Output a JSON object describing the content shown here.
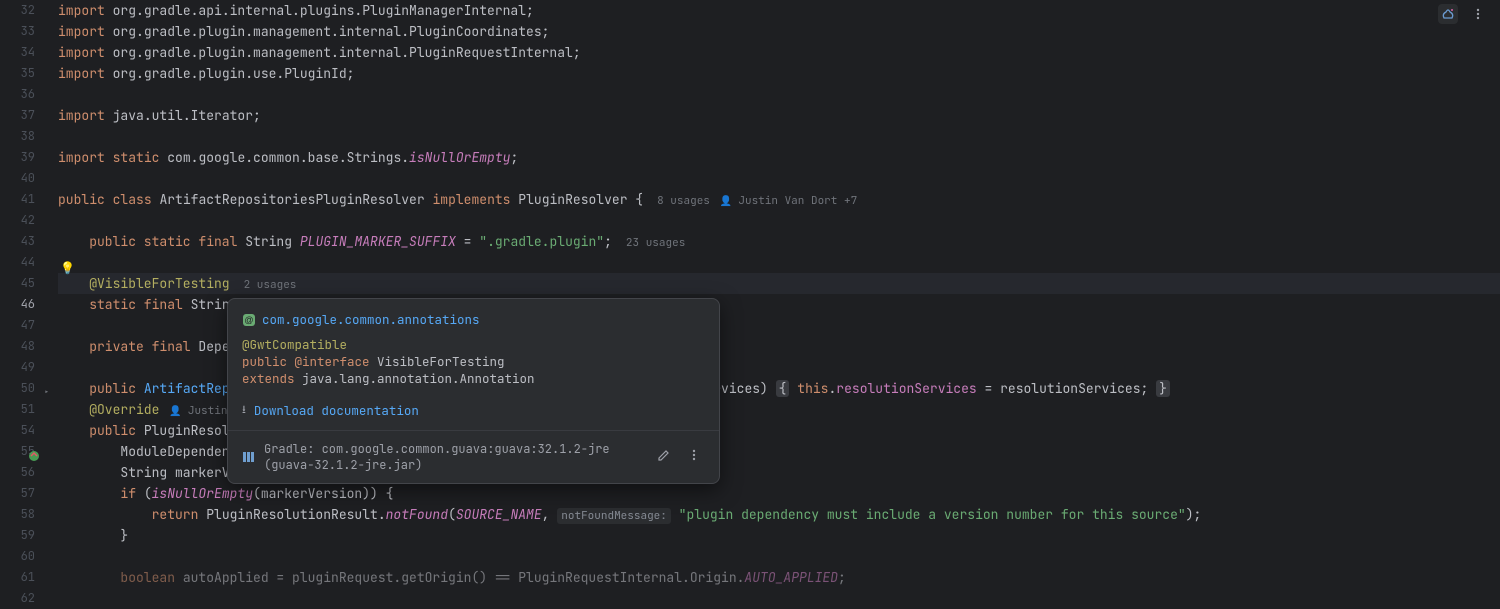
{
  "gutter": {
    "start": 32,
    "end": 62,
    "current": 46
  },
  "lines": {
    "l32": {
      "kw": "import",
      "rest": " org.gradle.api.internal.plugins.PluginManagerInternal;"
    },
    "l33": {
      "kw": "import",
      "rest": " org.gradle.plugin.management.internal.PluginCoordinates;"
    },
    "l34": {
      "kw": "import",
      "rest": " org.gradle.plugin.management.internal.PluginRequestInternal;"
    },
    "l35": {
      "kw": "import",
      "rest": " org.gradle.plugin.use.PluginId;"
    },
    "l37": {
      "kw": "import",
      "rest": " java.util.Iterator;"
    },
    "l39": {
      "kw1": "import",
      "kw2": "static",
      "rest": " com.google.common.base.Strings.",
      "m": "isNullOrEmpty",
      "end": ";"
    },
    "l41": {
      "kw1": "public",
      "kw2": "class",
      "name": "ArtifactRepositoriesPluginResolver",
      "kw3": "implements",
      "iface": "PluginResolver",
      "brace": " {",
      "usages": "8 usages",
      "author": "Justin Van Dort +7"
    },
    "l43": {
      "kw": "public static final",
      "type": "String",
      "name": "PLUGIN_MARKER_SUFFIX",
      "eq": " = ",
      "val": "\".gradle.plugin\"",
      "end": ";",
      "usages": "23 usages"
    },
    "l45": {
      "ann": "@VisibleForTesting",
      "usages": "2 usages"
    },
    "l46": {
      "kw": "static final",
      "type": "Strin"
    },
    "l48": {
      "kw": "private final",
      "type": "Depe"
    },
    "l50": {
      "kw": "public",
      "name": "ArtifactRep",
      "tail": "rvices) ",
      "b1": "{",
      "mid1": " ",
      "this": "this",
      "dot": ".",
      "field": "resolutionServices",
      "eq": " = resolutionServices; ",
      "b2": "}"
    },
    "l54": {
      "ann": "@Override",
      "author": "Justin V"
    },
    "l55": {
      "kw": "public",
      "type": "PluginResol"
    },
    "l56": {
      "text": "ModuleDependen"
    },
    "l57": {
      "text": "String markerV"
    },
    "l58": {
      "kw": "if",
      "open": " (",
      "m": "isNullOrEmpty",
      "args": "(markerVersion)) {"
    },
    "l59": {
      "kw": "return",
      "cls": " PluginResolutionResult.",
      "m": "notFound",
      "open": "(",
      "c": "SOURCE_NAME",
      "comma": ", ",
      "hint": "notFoundMessage:",
      "str": " \"plugin dependency must include a version number for this source\"",
      "end": ");"
    },
    "l60": {
      "text": "}"
    },
    "l62": {
      "kw": "boolean",
      "var": " autoApplied = pluginRequest.getOrigin() == PluginRequestInternal.Origin.",
      "c": "AUTO_APPLIED",
      "end": ";"
    }
  },
  "popup": {
    "package": "com.google.common.annotations",
    "sig_ann": "@GwtCompatible",
    "sig_l2_kw": "public ",
    "sig_l2_at": "@interface ",
    "sig_l2_name": "VisibleForTesting",
    "sig_l3_kw": "extends ",
    "sig_l3_rest": "java.lang.annotation.Annotation",
    "download": "Download documentation",
    "footer": "Gradle: com.google.common.guava:guava:32.1.2-jre (guava-32.1.2-jre.jar)"
  },
  "icons": {
    "bulb": "💡"
  }
}
